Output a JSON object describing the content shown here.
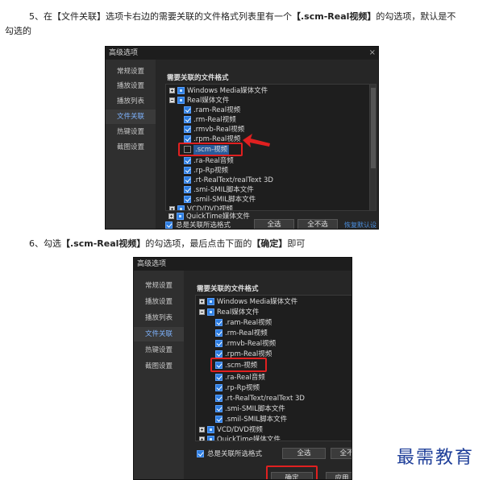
{
  "step5": {
    "prefix": "5、在【文件关联】选项卡右边的需要关联的文件格式列表里有一个",
    "bold": "【.scm-Real视频】",
    "suffix": "的勾选项，默认是不",
    "line2": "勾选的"
  },
  "step6": {
    "prefix": "6、勾选",
    "bold1": "【.scm-Real视频】",
    "mid": "的勾选项，最后点击下面的",
    "bold2": "【确定】",
    "suffix": "即可"
  },
  "dialog": {
    "title": "高级选项",
    "close": "×",
    "sidebar": [
      "常规设置",
      "播放设置",
      "播放列表",
      "文件关联",
      "热键设置",
      "截图设置"
    ],
    "active_tab": "文件关联",
    "heading": "需要关联的文件格式",
    "tree": [
      {
        "label": "Windows Media媒体文件",
        "level": 0,
        "expander": "plus",
        "check": "partial"
      },
      {
        "label": "Real媒体文件",
        "level": 0,
        "expander": "minus",
        "check": "partial"
      },
      {
        "label": ".ram-Real视频",
        "level": 1,
        "check": "checked"
      },
      {
        "label": ".rm-Real视频",
        "level": 1,
        "check": "checked"
      },
      {
        "label": ".rmvb-Real视频",
        "level": 1,
        "check": "checked"
      },
      {
        "label": ".rpm-Real视频",
        "level": 1,
        "check": "checked"
      },
      {
        "label": ".scm-视频",
        "level": 1,
        "check": "empty"
      },
      {
        "label": ".ra-Real音频",
        "level": 1,
        "check": "checked"
      },
      {
        "label": ".rp-Rp视频",
        "level": 1,
        "check": "checked"
      },
      {
        "label": ".rt-RealText/realText 3D",
        "level": 1,
        "check": "checked"
      },
      {
        "label": ".smi-SMIL脚本文件",
        "level": 1,
        "check": "checked"
      },
      {
        "label": ".smil-SMIL脚本文件",
        "level": 1,
        "check": "checked"
      },
      {
        "label": "VCD/DVD视频",
        "level": 0,
        "expander": "plus",
        "check": "partial"
      },
      {
        "label": "QuickTime媒体文件",
        "level": 0,
        "expander": "plus",
        "check": "partial"
      }
    ],
    "always_assoc": "总是关联所选格式",
    "select_all": "全选",
    "select_none": "全不选",
    "select_none_short": "全不",
    "restore_default": "恢复默认设置",
    "ok": "确定",
    "apply": "应用"
  },
  "watermark": "最需教育"
}
